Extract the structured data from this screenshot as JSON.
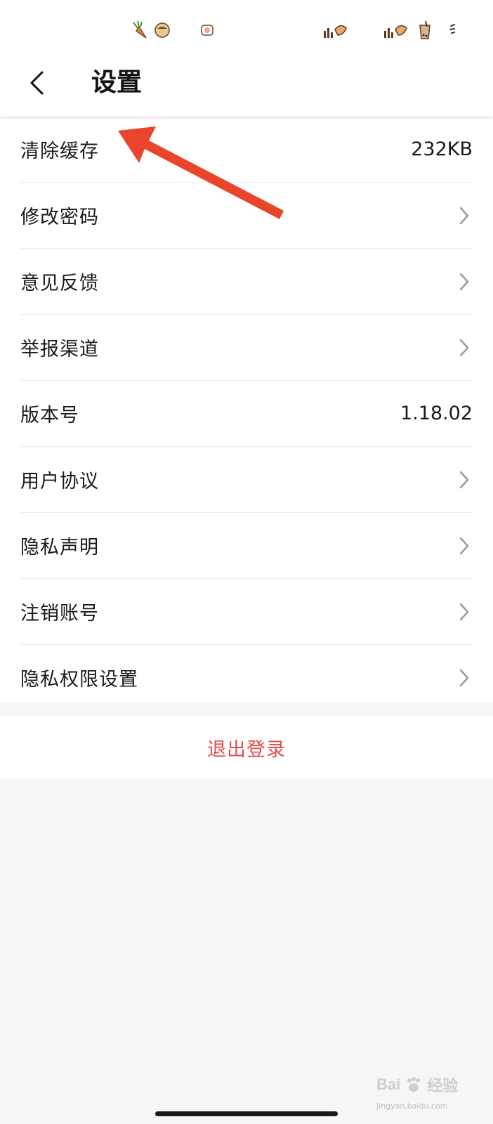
{
  "status_bar": {
    "icons": [
      "carrot-icon",
      "takoyaki-icon",
      "sushi-icon",
      "signal-taiyaki-icon",
      "signal-taiyaki-icon",
      "bubble-tea-icon",
      "battery-icon"
    ]
  },
  "header": {
    "title": "设置",
    "back_icon": "back-chevron-icon"
  },
  "settings": {
    "items": [
      {
        "label": "清除缓存",
        "value": "232KB",
        "has_chevron": false
      },
      {
        "label": "修改密码",
        "value": "",
        "has_chevron": true
      },
      {
        "label": "意见反馈",
        "value": "",
        "has_chevron": true
      },
      {
        "label": "举报渠道",
        "value": "",
        "has_chevron": true
      },
      {
        "label": "版本号",
        "value": "1.18.02",
        "has_chevron": false
      },
      {
        "label": "用户协议",
        "value": "",
        "has_chevron": true
      },
      {
        "label": "隐私声明",
        "value": "",
        "has_chevron": true
      },
      {
        "label": "注销账号",
        "value": "",
        "has_chevron": true
      },
      {
        "label": "隐私权限设置",
        "value": "",
        "has_chevron": true
      }
    ]
  },
  "logout": {
    "label": "退出登录"
  },
  "watermark": {
    "logo_text": "Bai",
    "logo_suffix": "经验",
    "sub_text": "jingyan.baidu.com"
  },
  "colors": {
    "background": "#f5f6f8",
    "logout_red": "#e04b4b",
    "annotation_red": "#e8452a",
    "chevron_gray": "#9a9a9a"
  }
}
